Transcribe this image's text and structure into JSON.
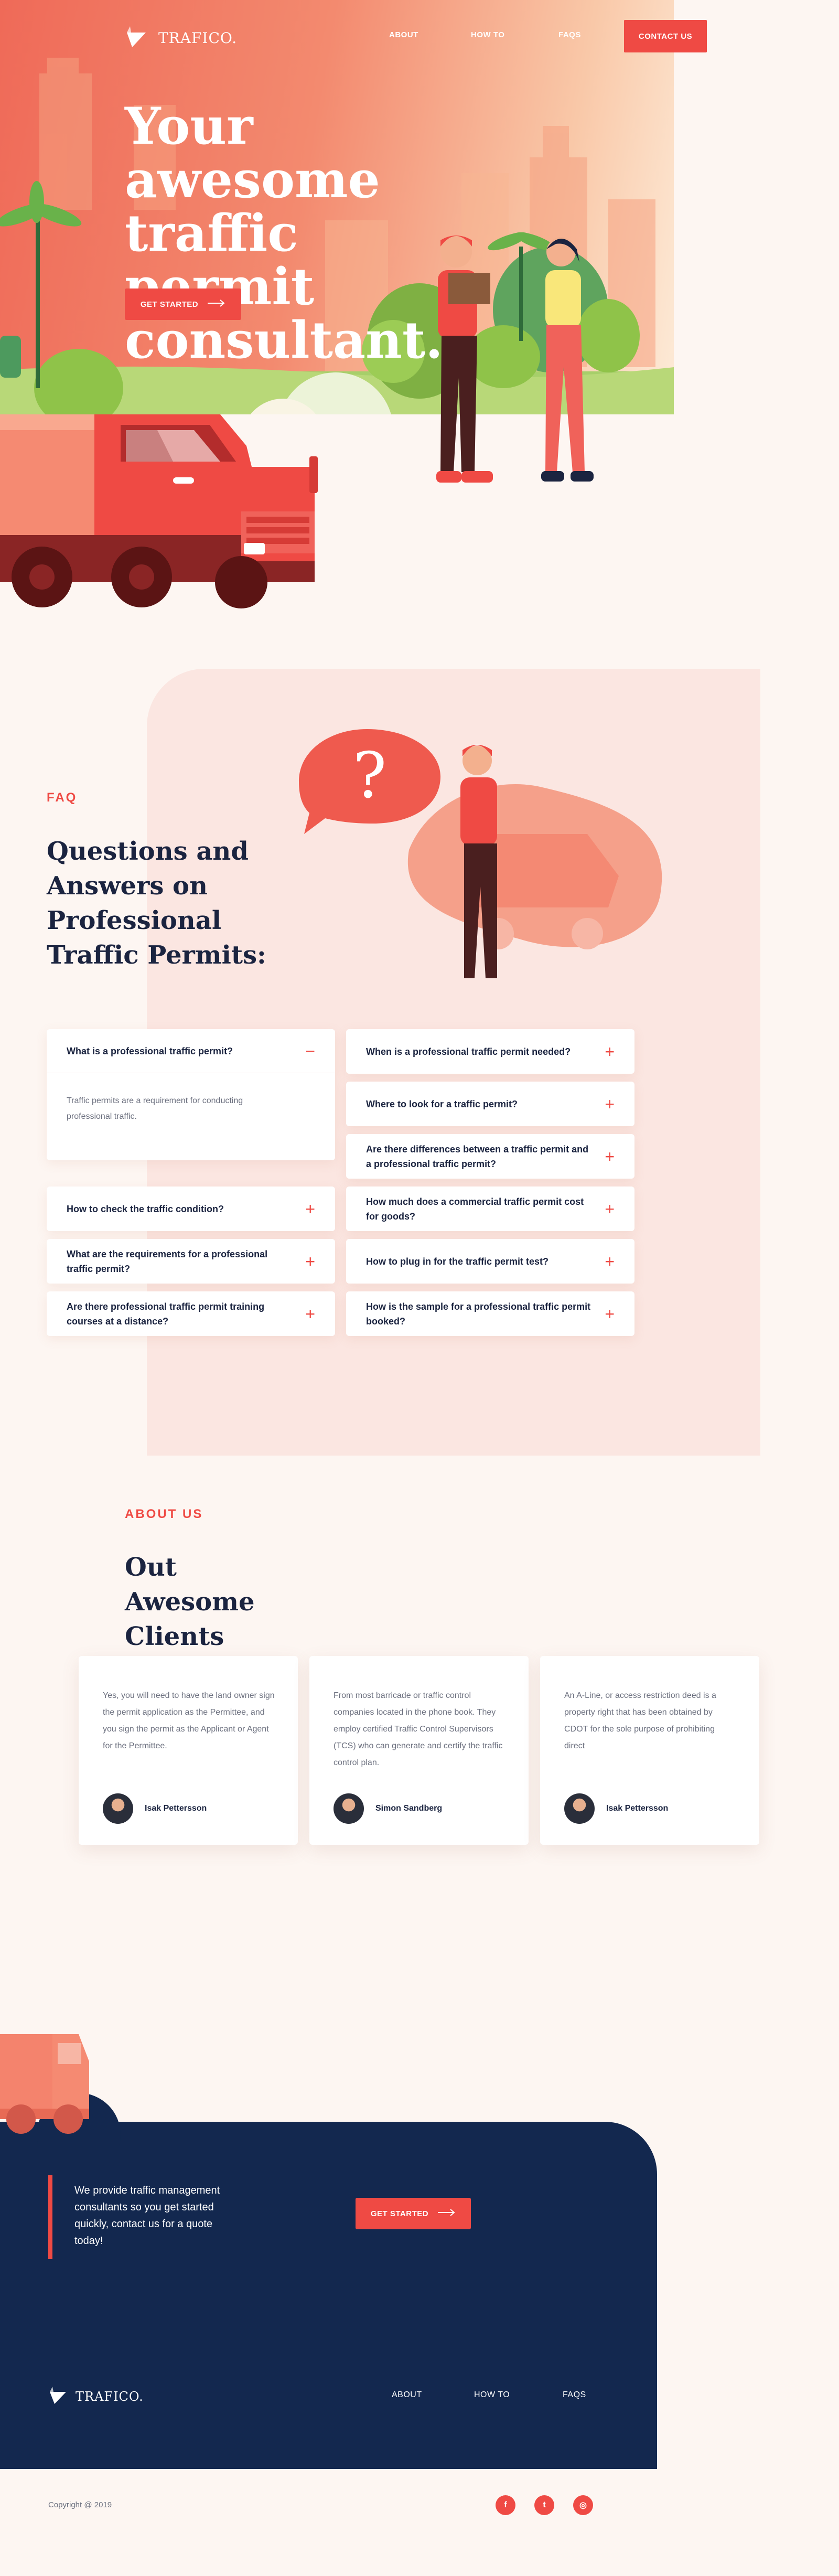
{
  "brand": {
    "name": "TRAFICO."
  },
  "nav": {
    "items": [
      {
        "label": "ABOUT"
      },
      {
        "label": "HOW TO"
      },
      {
        "label": "FAQS"
      }
    ],
    "cta": "CONTACT US"
  },
  "hero": {
    "title": "Your awesome traffic permit consultant.",
    "cta": "GET STARTED"
  },
  "faq": {
    "eyebrow": "FAQ",
    "title": "Questions and Answers on Professional Traffic Permits:",
    "left": [
      {
        "q": "What is a professional traffic permit?",
        "a": "Traffic permits are a requirement for conducting professional traffic.",
        "toggle": "−"
      },
      {
        "q": "How to check the traffic condition?",
        "toggle": "+"
      },
      {
        "q": "What are the requirements for a professional traffic permit?",
        "toggle": "+"
      },
      {
        "q": "Are there professional traffic permit training courses at a distance?",
        "toggle": "+"
      }
    ],
    "right": [
      {
        "q": "When is a professional traffic permit needed?",
        "toggle": "+"
      },
      {
        "q": "Where to look for a traffic permit?",
        "toggle": "+"
      },
      {
        "q": "Are there differences between a traffic permit and a professional traffic permit?",
        "toggle": "+"
      },
      {
        "q": "How much does a commercial traffic permit cost for goods?",
        "toggle": "+"
      },
      {
        "q": "How to plug in for the traffic permit test?",
        "toggle": "+"
      },
      {
        "q": "How is the sample for a professional traffic permit booked?",
        "toggle": "+"
      }
    ],
    "bubble": "?"
  },
  "about": {
    "eyebrow": "ABOUT US",
    "title": "Out Awesome Clients",
    "testimonials": [
      {
        "text": "Yes, you will need to have the land owner sign the permit application as the Permittee, and you sign the permit as the Applicant or Agent for the Permittee.",
        "author": "Isak Pettersson"
      },
      {
        "text": "From most barricade or traffic control companies located in the phone book. They employ certified Traffic Control Supervisors (TCS) who can generate and certify the traffic control plan.",
        "author": "Simon Sandberg"
      },
      {
        "text": "An A-Line, or access restriction deed is a property right that has been obtained by CDOT for the sole purpose of prohibiting direct",
        "author": "Isak Pettersson"
      }
    ]
  },
  "cta": {
    "text": "We provide traffic management consultants so you get started quickly, contact us for a quote today!",
    "button": "GET STARTED"
  },
  "footer": {
    "brand": "TRAFICO.",
    "links": [
      {
        "label": "ABOUT"
      },
      {
        "label": "HOW TO"
      },
      {
        "label": "FAQS"
      }
    ],
    "copyright": "Copyright @ 2019",
    "social": [
      {
        "icon": "facebook-icon",
        "glyph": "f"
      },
      {
        "icon": "twitter-icon",
        "glyph": "t"
      },
      {
        "icon": "instagram-icon",
        "glyph": "◎"
      }
    ]
  },
  "colors": {
    "accent": "#ef4a44",
    "navy": "#13284f",
    "panel": "#fbe6e1",
    "page": "#fdf6f2"
  }
}
